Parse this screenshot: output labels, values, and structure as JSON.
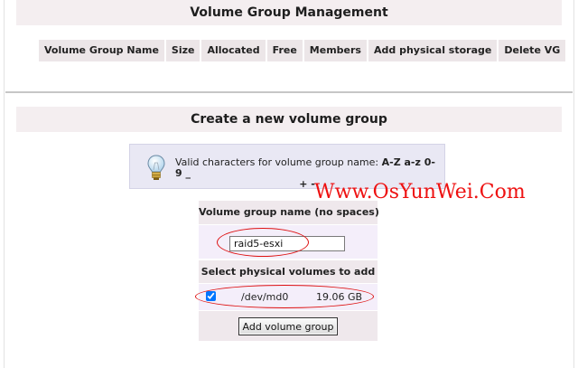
{
  "management": {
    "title": "Volume Group Management",
    "columns": [
      "Volume Group Name",
      "Size",
      "Allocated",
      "Free",
      "Members",
      "Add physical storage",
      "Delete VG"
    ]
  },
  "create": {
    "title": "Create a new volume group",
    "info_text": "Valid characters for volume group name: ",
    "info_chars_line1": "A-Z a-z 0-9 _",
    "info_chars_line2": "+ -",
    "name_label": "Volume group name (no spaces)",
    "name_value": "raid5-esxi",
    "pv_label": "Select physical volumes to add",
    "pv": {
      "device": "/dev/md0",
      "size": "19.06 GB",
      "checked": true
    },
    "submit_label": "Add volume group"
  },
  "watermark": "Www.OsYunWei.Com",
  "icons": {
    "info": "lightbulb-icon"
  },
  "colors": {
    "header_bg": "#f4eef0",
    "info_bg": "#e9e8f4",
    "annotation": "#dd1111"
  }
}
